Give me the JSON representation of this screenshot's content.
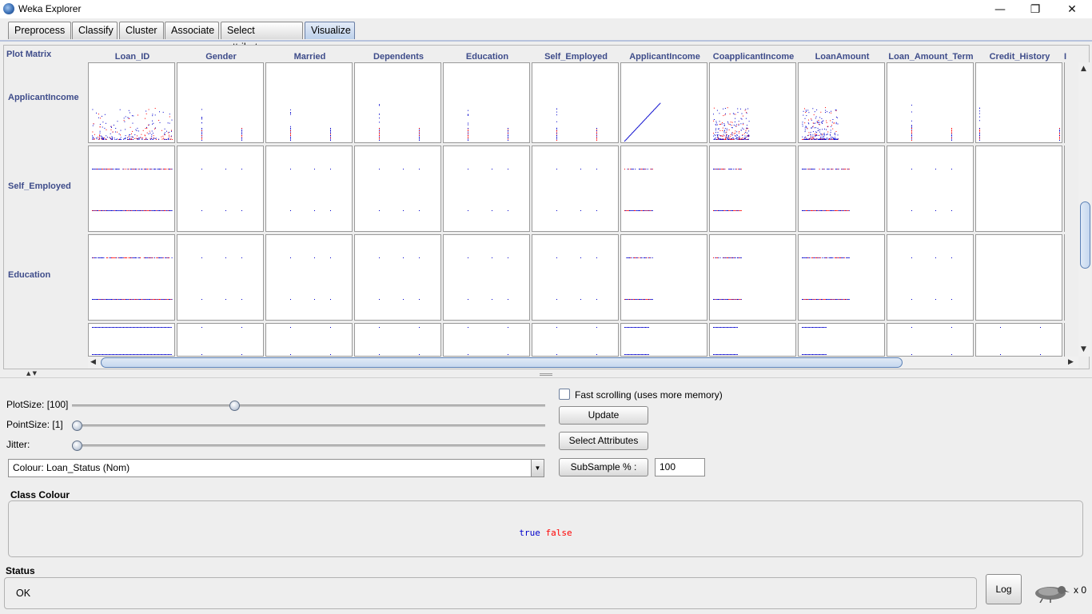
{
  "window": {
    "title": "Weka Explorer",
    "minimize": "—",
    "maximize": "❐",
    "close": "✕"
  },
  "tabs": [
    "Preprocess",
    "Classify",
    "Cluster",
    "Associate",
    "Select attributes",
    "Visualize"
  ],
  "active_tab": "Visualize",
  "matrix": {
    "label": "Plot Matrix",
    "columns": [
      "Loan_ID",
      "Gender",
      "Married",
      "Dependents",
      "Education",
      "Self_Employed",
      "ApplicantIncome",
      "CoapplicantIncome",
      "LoanAmount",
      "Loan_Amount_Term",
      "Credit_History",
      "I"
    ],
    "rows": [
      "ApplicantIncome",
      "Self_Employed",
      "Education"
    ],
    "colors": {
      "true": "#0000cc",
      "false": "#ff0000"
    }
  },
  "controls": {
    "plot_size_label": "PlotSize: [100]",
    "plot_size_level": 0.34,
    "point_size_label": "PointSize: [1]",
    "point_size_level": 0.0,
    "jitter_label": "Jitter:",
    "jitter_level": 0.0,
    "colour_select": "Colour: Loan_Status  (Nom)",
    "fast_scrolling_label": "Fast scrolling (uses more memory)",
    "fast_scrolling_checked": false,
    "update_button": "Update",
    "select_attributes_button": "Select Attributes",
    "subsample_button": "SubSample % :",
    "subsample_value": "100"
  },
  "class_colour": {
    "title": "Class Colour",
    "true_label": "true",
    "false_label": "false"
  },
  "status": {
    "title": "Status",
    "text": "OK",
    "log_button": "Log",
    "count": "x 0"
  }
}
